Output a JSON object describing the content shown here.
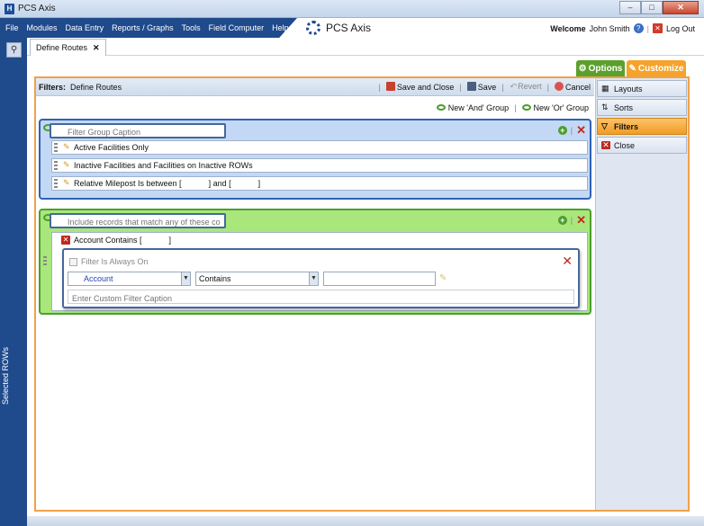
{
  "window": {
    "title": "PCS Axis"
  },
  "menu": {
    "items": [
      "File",
      "Modules",
      "Data Entry",
      "Reports / Graphs",
      "Tools",
      "Field Computer",
      "Help"
    ],
    "brand": "PCS Axis",
    "welcome_label": "Welcome",
    "user_name": "John Smith",
    "logout_label": "Log Out"
  },
  "rail": {
    "label": "Selected ROWs"
  },
  "tabs": {
    "active_label": "Define Routes",
    "close_glyph": "✕"
  },
  "top_buttons": {
    "options_label": "Options",
    "customize_label": "Customize"
  },
  "filter_bar": {
    "label": "Filters:",
    "name": "Define Routes",
    "save_close_label": "Save and Close",
    "save_label": "Save",
    "revert_label": "Revert",
    "cancel_label": "Cancel"
  },
  "group_links": {
    "new_and": "New 'And' Group",
    "new_or": "New 'Or' Group"
  },
  "and_group": {
    "caption_placeholder": "Filter Group Caption",
    "conditions": [
      "Active Facilities Only",
      "Inactive Facilities and Facilities on Inactive ROWs",
      "Relative Milepost Is between [            ] and [            ]"
    ]
  },
  "or_group": {
    "caption_placeholder": "Include records that match any of these conditions",
    "condition": "Account Contains [            ]",
    "editor": {
      "always_on_label": "Filter Is Always On",
      "field_value": "Account",
      "operator_value": "Contains",
      "value": "",
      "custom_caption_placeholder": "Enter Custom Filter Caption"
    }
  },
  "side_panel": {
    "items": [
      "Layouts",
      "Sorts",
      "Filters",
      "Close"
    ],
    "active": "Filters"
  },
  "colors": {
    "accent_blue": "#1f4a8c",
    "options_green": "#5aa02c",
    "customize_orange": "#f5a32a",
    "and_group_fill": "#c3d8f4",
    "or_group_fill": "#a9e67c"
  }
}
